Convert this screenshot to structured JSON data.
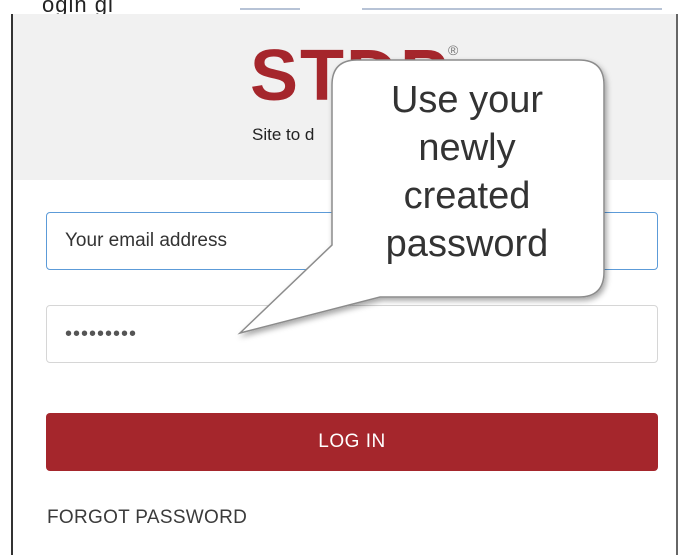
{
  "top_strip": {
    "text": "ogin gi"
  },
  "header": {
    "logo_text": "STDP",
    "logo_registered": "®",
    "tagline": "Site to d"
  },
  "login_form": {
    "email_placeholder": "Your email address",
    "email_value": "",
    "password_value": "password1",
    "login_button_label": "LOG IN",
    "forgot_password_label": "FORGOT PASSWORD"
  },
  "callout": {
    "lines": [
      "Use your",
      "newly",
      "created",
      "password"
    ]
  },
  "colors": {
    "brand_red": "#a5262c",
    "focus_blue": "#5c9bd8",
    "header_gray": "#f1f1f1"
  },
  "icons": {
    "logo_mark": "registered-trademark-icon"
  }
}
